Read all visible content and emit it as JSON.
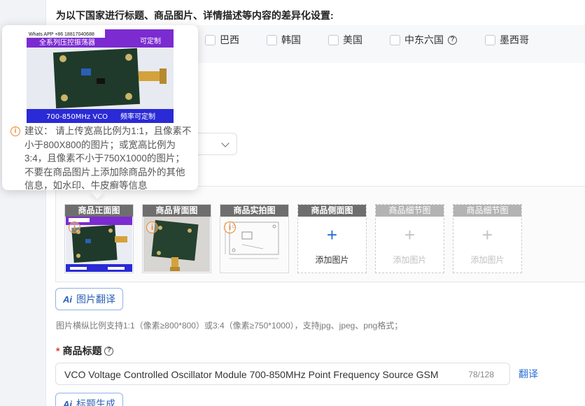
{
  "section_title": "为以下国家进行标题、商品图片、详情描述等内容的差异化设置:",
  "countries": [
    {
      "label": "巴西"
    },
    {
      "label": "韩国"
    },
    {
      "label": "美国"
    },
    {
      "label": "中东六国"
    },
    {
      "label": "墨西哥"
    }
  ],
  "tooltip": {
    "preview": {
      "watermark": "Whats APP +86 18817040688",
      "banner_top_left": "全系列压控振荡器",
      "banner_top_right": "可定制",
      "banner_bottom_left": "700-850MHz VCO",
      "banner_bottom_right": "频率可定制"
    },
    "text": "建议： 请上传宽高比例为1:1，且像素不小于800X800的图片；或宽高比例为3:4，且像素不小于750X1000的图片；不要在商品图片上添加除商品外的其他信息，如水印、牛皮癣等信息"
  },
  "image_slots": [
    {
      "label": "商品正面图"
    },
    {
      "label": "商品背面图"
    },
    {
      "label": "商品实拍图"
    },
    {
      "label": "商品侧面图",
      "add_text": "添加图片"
    },
    {
      "label": "商品细节图",
      "add_text": "添加图片"
    },
    {
      "label": "商品细节图",
      "add_text": "添加图片"
    }
  ],
  "image_translate_button": "图片翻译",
  "image_hint": "图片横纵比例支持1:1（像素≥800*800）或3:4（像素≥750*1000），支持jpg、jpeg、png格式；",
  "product_title": {
    "label": "商品标题",
    "value": "VCO Voltage Controlled Oscillator Module 700-850MHz Point Frequency Source GSM",
    "count": "78/128",
    "translate_link": "翻译"
  },
  "title_generate_button": "标题生成",
  "colors": {
    "accent": "#2a6fd6",
    "warning": "#f0862a",
    "required": "#e23b2e",
    "pcb_green": "#1f3a2a",
    "banner_purple": "#7b2bd0",
    "banner_blue": "#2a2ad6"
  }
}
